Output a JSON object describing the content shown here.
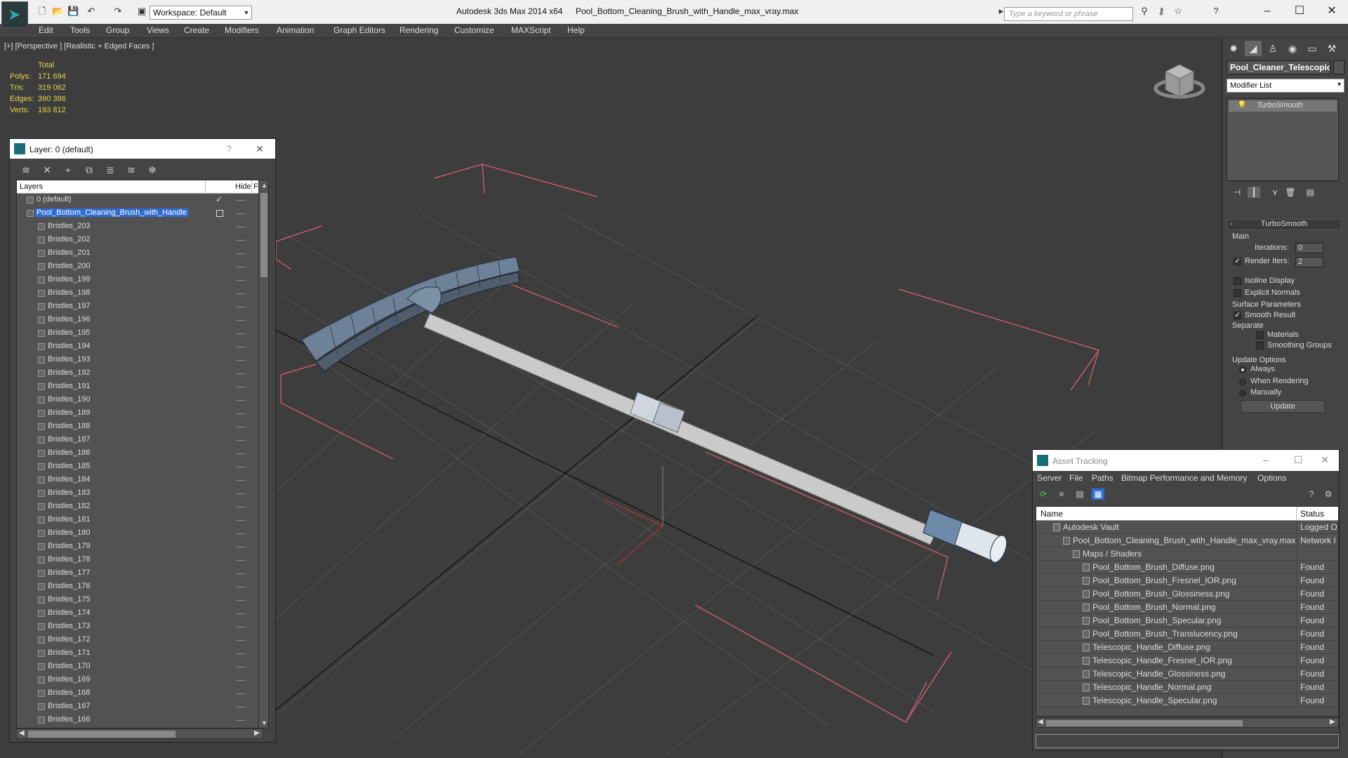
{
  "titlebar": {
    "workspace": "Workspace: Default",
    "app_title": "Autodesk 3ds Max  2014 x64",
    "file_name": "Pool_Bottom_Cleaning_Brush_with_Handle_max_vray.max",
    "search_placeholder": "Type a keyword or phrase"
  },
  "menu": [
    "Edit",
    "Tools",
    "Group",
    "Views",
    "Create",
    "Modifiers",
    "Animation",
    "Graph Editors",
    "Rendering",
    "Customize",
    "MAXScript",
    "Help"
  ],
  "viewport": {
    "label": "[+] [Perspective ] [Realistic + Edged Faces ]",
    "stats": {
      "header": "Total",
      "rows": [
        {
          "label": "Polys:",
          "value": "171 694"
        },
        {
          "label": "Tris:",
          "value": "319 062"
        },
        {
          "label": "Edges:",
          "value": "390 386"
        },
        {
          "label": "Verts:",
          "value": "193 812"
        }
      ]
    }
  },
  "layer_dialog": {
    "title": "Layer: 0 (default)",
    "help": "?",
    "close": "✕",
    "columns": {
      "layers": "Layers",
      "hide": "Hide",
      "freeze": "Fr"
    },
    "rows": [
      {
        "name": "0 (default)",
        "indent": 1,
        "marker": "check"
      },
      {
        "name": "Pool_Bottom_Cleaning_Brush_with_Handle",
        "indent": 1,
        "marker": "square",
        "selected": true
      },
      {
        "name": "Bristles_203",
        "indent": 2
      },
      {
        "name": "Bristles_202",
        "indent": 2
      },
      {
        "name": "Bristles_201",
        "indent": 2
      },
      {
        "name": "Bristles_200",
        "indent": 2
      },
      {
        "name": "Bristles_199",
        "indent": 2
      },
      {
        "name": "Bristles_198",
        "indent": 2
      },
      {
        "name": "Bristles_197",
        "indent": 2
      },
      {
        "name": "Bristles_196",
        "indent": 2
      },
      {
        "name": "Bristles_195",
        "indent": 2
      },
      {
        "name": "Bristles_194",
        "indent": 2
      },
      {
        "name": "Bristles_193",
        "indent": 2
      },
      {
        "name": "Bristles_192",
        "indent": 2
      },
      {
        "name": "Bristles_191",
        "indent": 2
      },
      {
        "name": "Bristles_190",
        "indent": 2
      },
      {
        "name": "Bristles_189",
        "indent": 2
      },
      {
        "name": "Bristles_188",
        "indent": 2
      },
      {
        "name": "Bristles_187",
        "indent": 2
      },
      {
        "name": "Bristles_186",
        "indent": 2
      },
      {
        "name": "Bristles_185",
        "indent": 2
      },
      {
        "name": "Bristles_184",
        "indent": 2
      },
      {
        "name": "Bristles_183",
        "indent": 2
      },
      {
        "name": "Bristles_182",
        "indent": 2
      },
      {
        "name": "Bristles_181",
        "indent": 2
      },
      {
        "name": "Bristles_180",
        "indent": 2
      },
      {
        "name": "Bristles_179",
        "indent": 2
      },
      {
        "name": "Bristles_178",
        "indent": 2
      },
      {
        "name": "Bristles_177",
        "indent": 2
      },
      {
        "name": "Bristles_176",
        "indent": 2
      },
      {
        "name": "Bristles_175",
        "indent": 2
      },
      {
        "name": "Bristles_174",
        "indent": 2
      },
      {
        "name": "Bristles_173",
        "indent": 2
      },
      {
        "name": "Bristles_172",
        "indent": 2
      },
      {
        "name": "Bristles_171",
        "indent": 2
      },
      {
        "name": "Bristles_170",
        "indent": 2
      },
      {
        "name": "Bristles_169",
        "indent": 2
      },
      {
        "name": "Bristles_168",
        "indent": 2
      },
      {
        "name": "Bristles_167",
        "indent": 2
      },
      {
        "name": "Bristles_166",
        "indent": 2
      }
    ]
  },
  "command_panel": {
    "object_name": "Pool_Cleaner_Telescopic",
    "modifier_list": "Modifier List",
    "stack_item": "TurboSmooth",
    "rollout_title": "TurboSmooth",
    "main_group": "Main",
    "iterations_label": "Iterations:",
    "iterations_value": "0",
    "render_iters_label": "Render Iters:",
    "render_iters_value": "2",
    "isoline": "Isoline Display",
    "explicit_normals": "Explicit Normals",
    "surface_params": "Surface Parameters",
    "smooth_result": "Smooth Result",
    "separate": "Separate",
    "materials": "Materials",
    "smoothing_groups": "Smoothing Groups",
    "update_options": "Update Options",
    "always": "Always",
    "when_rendering": "When Rendering",
    "manually": "Manually",
    "update_button": "Update"
  },
  "asset_tracking": {
    "title": "Asset Tracking",
    "menu": [
      "Server",
      "File",
      "Paths",
      "Bitmap Performance and Memory",
      "Options"
    ],
    "columns": {
      "name": "Name",
      "status": "Status"
    },
    "rows": [
      {
        "name": "Autodesk Vault",
        "indent": 1,
        "status": "Logged O"
      },
      {
        "name": "Pool_Bottom_Cleaning_Brush_with_Handle_max_vray.max",
        "indent": 2,
        "status": "Network I"
      },
      {
        "name": "Maps / Shaders",
        "indent": 3,
        "status": ""
      },
      {
        "name": "Pool_Bottom_Brush_Diffuse.png",
        "indent": 4,
        "status": "Found"
      },
      {
        "name": "Pool_Bottom_Brush_Fresnel_IOR.png",
        "indent": 4,
        "status": "Found"
      },
      {
        "name": "Pool_Bottom_Brush_Glossiness.png",
        "indent": 4,
        "status": "Found"
      },
      {
        "name": "Pool_Bottom_Brush_Normal.png",
        "indent": 4,
        "status": "Found"
      },
      {
        "name": "Pool_Bottom_Brush_Specular.png",
        "indent": 4,
        "status": "Found"
      },
      {
        "name": "Pool_Bottom_Brush_Translucency.png",
        "indent": 4,
        "status": "Found"
      },
      {
        "name": "Telescopic_Handle_Diffuse.png",
        "indent": 4,
        "status": "Found"
      },
      {
        "name": "Telescopic_Handle_Fresnel_IOR.png",
        "indent": 4,
        "status": "Found"
      },
      {
        "name": "Telescopic_Handle_Glossiness.png",
        "indent": 4,
        "status": "Found"
      },
      {
        "name": "Telescopic_Handle_Normal.png",
        "indent": 4,
        "status": "Found"
      },
      {
        "name": "Telescopic_Handle_Specular.png",
        "indent": 4,
        "status": "Found"
      }
    ]
  },
  "colors": {
    "selection": "#2f6dd2",
    "bbox_lines": "#e0607a",
    "stats_yellow": "#e6d44a"
  }
}
